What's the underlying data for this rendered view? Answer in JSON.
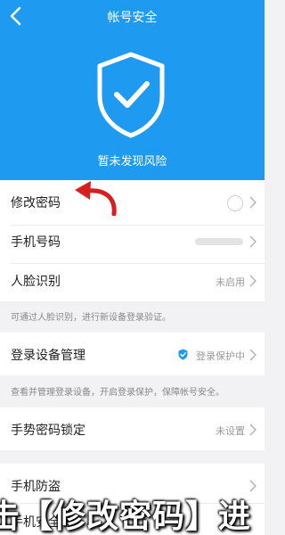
{
  "header": {
    "title": "帐号安全",
    "status": "暂未发现风险",
    "bg": "#1e9bf0"
  },
  "items": [
    {
      "label": "修改密码",
      "value": ""
    },
    {
      "label": "手机号码",
      "value": ""
    },
    {
      "label": "人脸识别",
      "value": "未启用"
    },
    {
      "label": "登录设备管理",
      "value": "登录保护中"
    },
    {
      "label": "手势密码锁定",
      "value": "未设置"
    },
    {
      "label": "手机防盗",
      "value": ""
    },
    {
      "label": "手机安全防",
      "value": ""
    }
  ],
  "hints": {
    "face": "可通过人脸识别，进行新设备登录验证。",
    "device": "查看并管理登录设备，开启登录保护，保障帐号安全。"
  },
  "caption": {
    "text": "击【修改密码】进",
    "color": "#ffffff"
  },
  "arrow_color": "#d62020"
}
